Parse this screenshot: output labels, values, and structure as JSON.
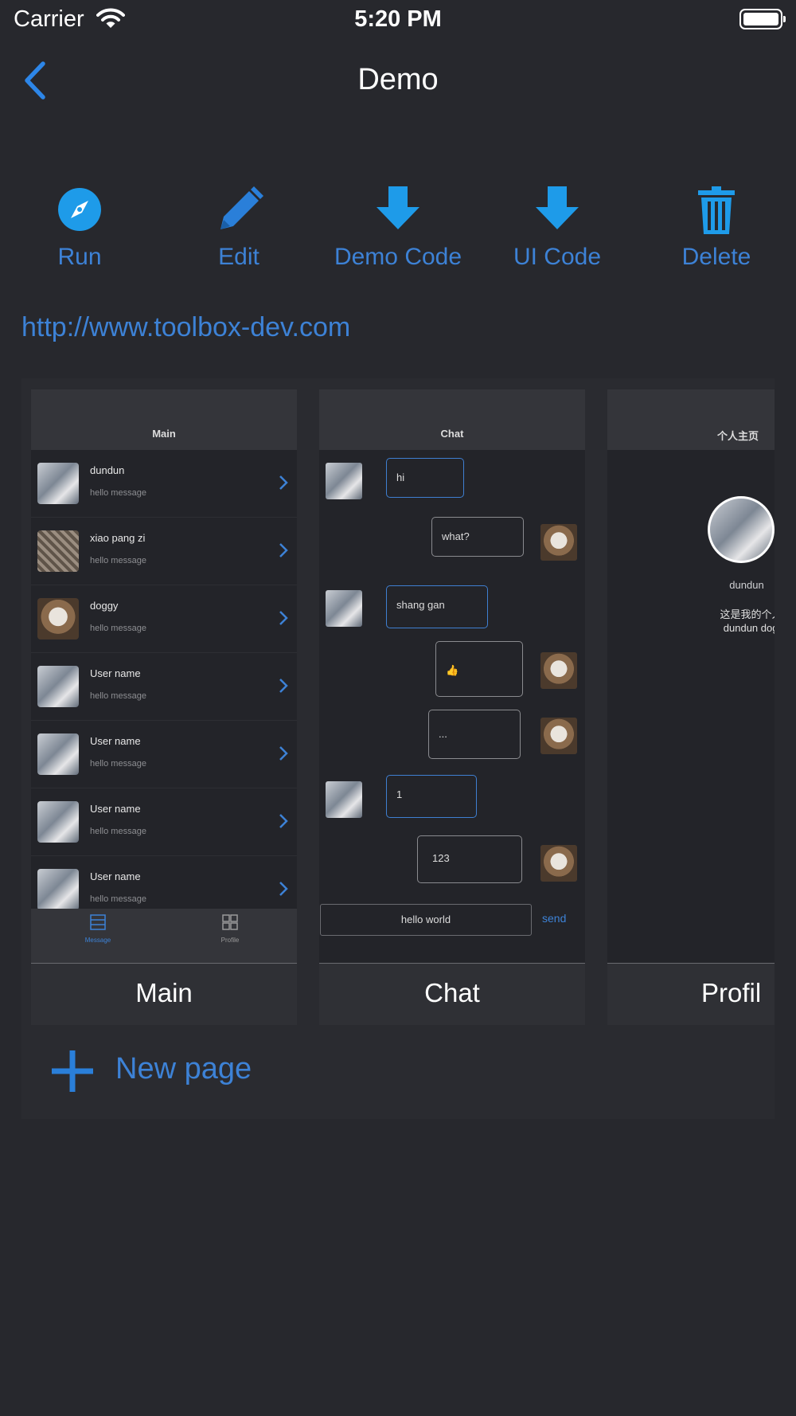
{
  "status_bar": {
    "carrier": "Carrier",
    "time": "5:20 PM"
  },
  "nav": {
    "title": "Demo"
  },
  "toolbar": [
    {
      "label": "Run",
      "icon": "compass-icon"
    },
    {
      "label": "Edit",
      "icon": "pencil-icon"
    },
    {
      "label": "Demo Code",
      "icon": "download-arrow-icon"
    },
    {
      "label": "UI Code",
      "icon": "download-arrow-icon"
    },
    {
      "label": "Delete",
      "icon": "trash-icon"
    }
  ],
  "link": "http://www.toolbox-dev.com",
  "pages": [
    {
      "label": "Main",
      "screen_title": "Main",
      "rows": [
        {
          "name": "dundun",
          "message": "hello message"
        },
        {
          "name": "xiao pang zi",
          "message": "hello message"
        },
        {
          "name": "doggy",
          "message": "hello message"
        },
        {
          "name": "User name",
          "message": "hello message"
        },
        {
          "name": "User name",
          "message": "hello message"
        },
        {
          "name": "User name",
          "message": "hello message"
        },
        {
          "name": "User name",
          "message": "hello message"
        }
      ],
      "tabs": [
        "Message",
        "Profile"
      ]
    },
    {
      "label": "Chat",
      "screen_title": "Chat",
      "messages": [
        "hi",
        "what?",
        "shang gan",
        "👍",
        "...",
        "1",
        "123"
      ],
      "input_value": "hello world",
      "send_label": "send"
    },
    {
      "label": "Profil",
      "screen_title": "个人主页",
      "name": "dundun",
      "desc_line1": "这是我的个人主",
      "desc_line2": "dundun doggy"
    }
  ],
  "new_page_label": "New page",
  "colors": {
    "accent": "#3d82d6",
    "icon_blue": "#1e9be9",
    "background": "#27282d"
  }
}
